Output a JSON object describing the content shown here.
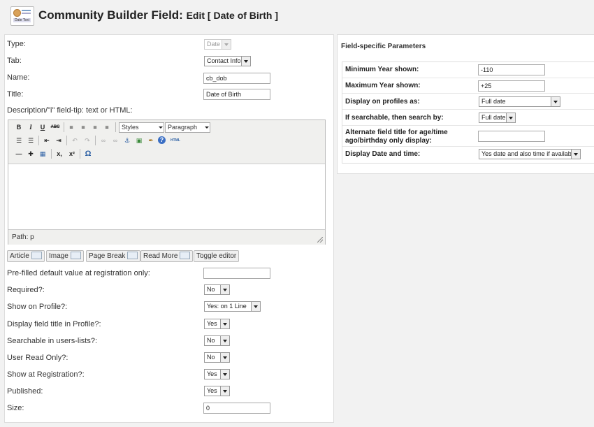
{
  "header": {
    "icon_text": "Date Text",
    "title": "Community Builder Field:",
    "subtitle": "Edit [ Date of Birth ]"
  },
  "form": {
    "type": {
      "label": "Type:",
      "value": "Date"
    },
    "tab": {
      "label": "Tab:",
      "value": "Contact Info"
    },
    "name": {
      "label": "Name:",
      "value": "cb_dob"
    },
    "title": {
      "label": "Title:",
      "value": "Date of Birth"
    },
    "description": {
      "label": "Description/\"i\" field-tip: text or HTML:"
    },
    "prefilled": {
      "label": "Pre-filled default value at registration only:",
      "value": ""
    },
    "required": {
      "label": "Required?:",
      "value": "No"
    },
    "show_on_profile": {
      "label": "Show on Profile?:",
      "value": "Yes: on 1 Line"
    },
    "display_title": {
      "label": "Display field title in Profile?:",
      "value": "Yes"
    },
    "searchable": {
      "label": "Searchable in users-lists?:",
      "value": "No"
    },
    "read_only": {
      "label": "User Read Only?:",
      "value": "No"
    },
    "show_registration": {
      "label": "Show at Registration?:",
      "value": "Yes"
    },
    "published": {
      "label": "Published:",
      "value": "Yes"
    },
    "size": {
      "label": "Size:",
      "value": "0"
    }
  },
  "editor": {
    "styles": "Styles",
    "format": "Paragraph",
    "path": "Path: p",
    "buttons": {
      "bold": "B",
      "italic": "I",
      "underline": "U",
      "strike": "ABC",
      "subscript": "x,",
      "superscript": "x²",
      "charmap": "Ω",
      "html": "HTML"
    }
  },
  "editor_buttons": {
    "article": "Article",
    "image": "Image",
    "pagebreak": "Page Break",
    "readmore": "Read More",
    "toggle": "Toggle editor"
  },
  "params": {
    "title": "Field-specific Parameters",
    "min_year": {
      "label": "Minimum Year shown:",
      "value": "-110"
    },
    "max_year": {
      "label": "Maximum Year shown:",
      "value": "+25"
    },
    "display_as": {
      "label": "Display on profiles as:",
      "value": "Full date"
    },
    "search_by": {
      "label": "If searchable, then search by:",
      "value": "Full date"
    },
    "alt_title": {
      "label_1": "Alternate field title for age/time",
      "label_2": "ago/birthday only display:",
      "value": ""
    },
    "date_time": {
      "label": "Display Date and time:",
      "value": "Yes date and also time if available"
    }
  }
}
